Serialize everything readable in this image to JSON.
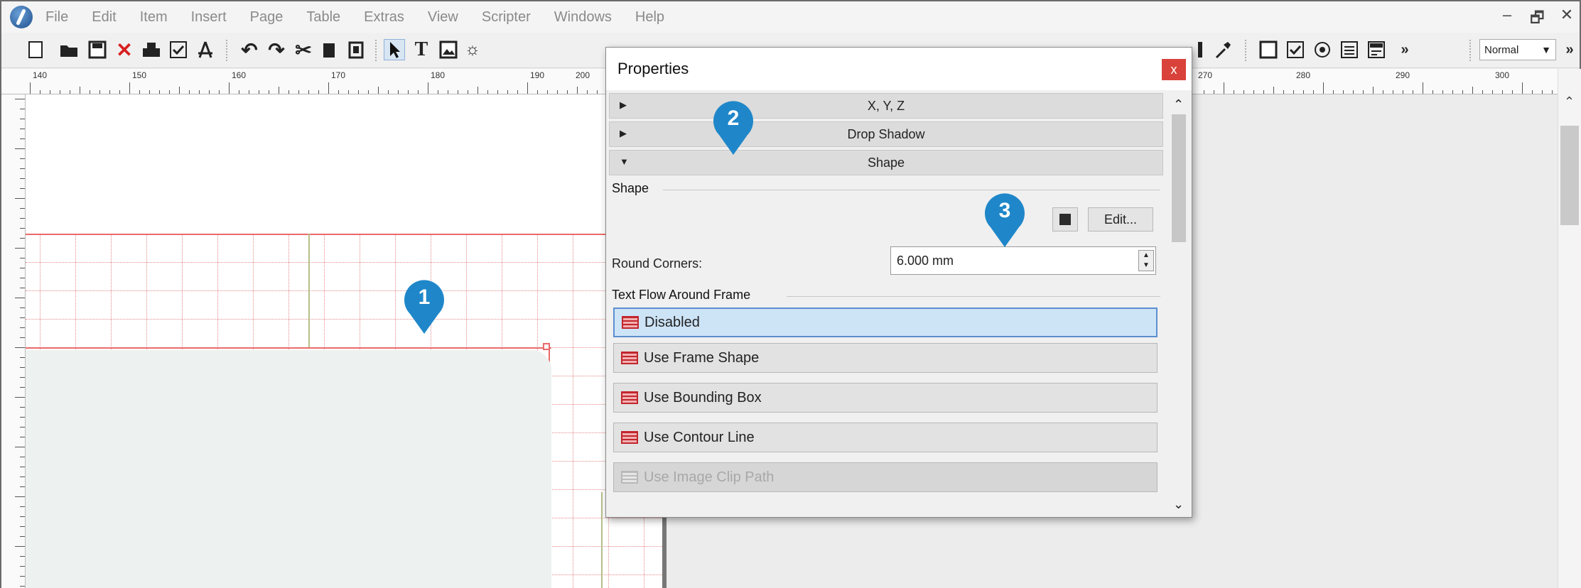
{
  "menubar": {
    "items": [
      "File",
      "Edit",
      "Item",
      "Insert",
      "Page",
      "Table",
      "Extras",
      "View",
      "Scripter",
      "Windows",
      "Help"
    ],
    "window_controls": [
      "–",
      "🗗",
      "✕"
    ]
  },
  "toolbar": {
    "mode_select": "Normal"
  },
  "ruler": {
    "labels": [
      "140",
      "150",
      "160",
      "170",
      "180",
      "190",
      "200",
      "270",
      "280",
      "290",
      "300"
    ]
  },
  "properties": {
    "title": "Properties",
    "close": "x",
    "sections": [
      {
        "label": "X, Y, Z",
        "expanded": false
      },
      {
        "label": "Drop Shadow",
        "expanded": false
      },
      {
        "label": "Shape",
        "expanded": true
      }
    ],
    "shape_group_label": "Shape",
    "edit_button": "Edit...",
    "round_corners_label": "Round Corners:",
    "round_corners_value": "6.000 mm",
    "text_flow_group_label": "Text Flow Around Frame",
    "text_flow_options": [
      {
        "label": "Disabled",
        "state": "selected"
      },
      {
        "label": "Use Frame Shape",
        "state": "normal"
      },
      {
        "label": "Use Bounding Box",
        "state": "normal"
      },
      {
        "label": "Use Contour Line",
        "state": "normal"
      },
      {
        "label": "Use Image Clip Path",
        "state": "disabled"
      }
    ]
  },
  "callouts": [
    "1",
    "2",
    "3"
  ],
  "colors": {
    "callout": "#1f87c9",
    "guide_red": "#ea6a6a",
    "close_red": "#d9423a",
    "selection_blue": "#cde4f7"
  }
}
